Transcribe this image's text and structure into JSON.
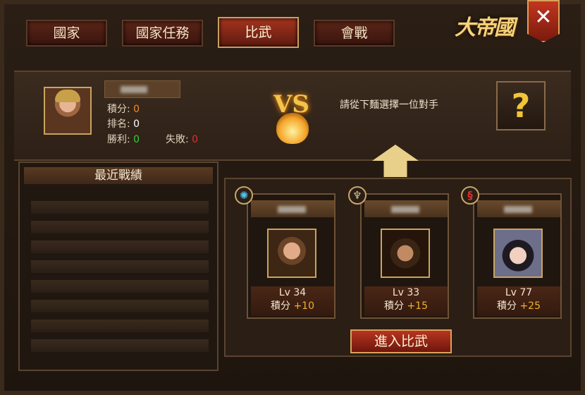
{
  "tabs": [
    {
      "label": "國家",
      "active": false
    },
    {
      "label": "國家任務",
      "active": false
    },
    {
      "label": "比武",
      "active": true
    },
    {
      "label": "會戰",
      "active": false
    }
  ],
  "logo_text": "大帝國",
  "close_glyph": "✕",
  "player": {
    "score_label": "積分:",
    "score_value": "0",
    "rank_label": "排名:",
    "rank_value": "0",
    "wins_label": "勝利:",
    "wins_value": "0",
    "losses_label": "失敗:",
    "losses_value": "0"
  },
  "vs_text": "VS",
  "prompt": "請從下麵選擇一位對手",
  "unknown_glyph": "?",
  "records": {
    "title": "最近戰績"
  },
  "opponents": [
    {
      "emblem_icon": "water-emblem-icon",
      "level": "Lv 34",
      "score_label": "積分",
      "score_bonus": "+10"
    },
    {
      "emblem_icon": "eagle-emblem-icon",
      "level": "Lv 33",
      "score_label": "積分",
      "score_bonus": "+15"
    },
    {
      "emblem_icon": "dragon-emblem-icon",
      "level": "Lv 77",
      "score_label": "積分",
      "score_bonus": "+25"
    }
  ],
  "enter_button": "進入比武",
  "colors": {
    "accent_red": "#a5341f",
    "gold": "#c9a45e",
    "score_orange": "#f08a24",
    "win_green": "#2fd03c",
    "loss_red": "#e0302a"
  }
}
